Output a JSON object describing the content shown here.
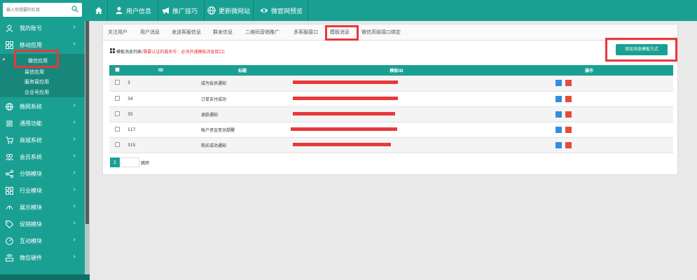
{
  "search": {
    "placeholder": "输入你想要的栏目"
  },
  "sidebar": {
    "items": [
      {
        "label": "我的账号",
        "icon": "user-icon"
      },
      {
        "label": "移动应用",
        "icon": "apps-icon"
      },
      {
        "label": "微网系统",
        "icon": "globe-icon"
      },
      {
        "label": "通用功能",
        "icon": "puzzle-icon"
      },
      {
        "label": "商城系统",
        "icon": "cart-icon"
      },
      {
        "label": "会员系统",
        "icon": "members-icon"
      },
      {
        "label": "分销模块",
        "icon": "share-icon"
      },
      {
        "label": "行业模块",
        "icon": "grid-icon"
      },
      {
        "label": "展示模块",
        "icon": "display-icon"
      },
      {
        "label": "促销模块",
        "icon": "tag-icon"
      },
      {
        "label": "互动模块",
        "icon": "gauge-icon"
      },
      {
        "label": "微信硬件",
        "icon": "router-icon"
      }
    ],
    "chevron": "›",
    "sub_items": [
      "微信应用",
      "易信应用",
      "服务窗应用",
      "企业号应用"
    ],
    "sub_arrow": "»"
  },
  "topbar": {
    "items": [
      {
        "label": "",
        "icon": "home-icon"
      },
      {
        "label": "用户信息",
        "icon": "user-icon"
      },
      {
        "label": "推广技巧",
        "icon": "megaphone-icon"
      },
      {
        "label": "更新微网站",
        "icon": "globe-icon"
      },
      {
        "label": "微官网预览",
        "icon": "eye-icon"
      }
    ]
  },
  "tabs": [
    "关注用户",
    "用户消息",
    "发送客服信息",
    "群发信息",
    "二维码营销推广",
    "多客服接口",
    "模板消息",
    "微信高级接口绑定"
  ],
  "section": {
    "title": "模板消息列表",
    "warning": "(需要认证的服务号：必须开通模板消息接口)"
  },
  "add_button": "添加消息模板方式",
  "table": {
    "headers": [
      "ID",
      "标题",
      "模板ID",
      "操作"
    ],
    "rows": [
      {
        "id": "3",
        "title": "成为会员通知"
      },
      {
        "id": "34",
        "title": "订单支付成功"
      },
      {
        "id": "35",
        "title": "退款通知"
      },
      {
        "id": "117",
        "title": "帐户资金变动提醒"
      },
      {
        "id": "315",
        "title": "购买成功通知"
      }
    ]
  },
  "pager": {
    "current": "1",
    "go_label": "跳转"
  },
  "colors": {
    "accent": "#1aa093",
    "highlight": "#e7393a"
  }
}
